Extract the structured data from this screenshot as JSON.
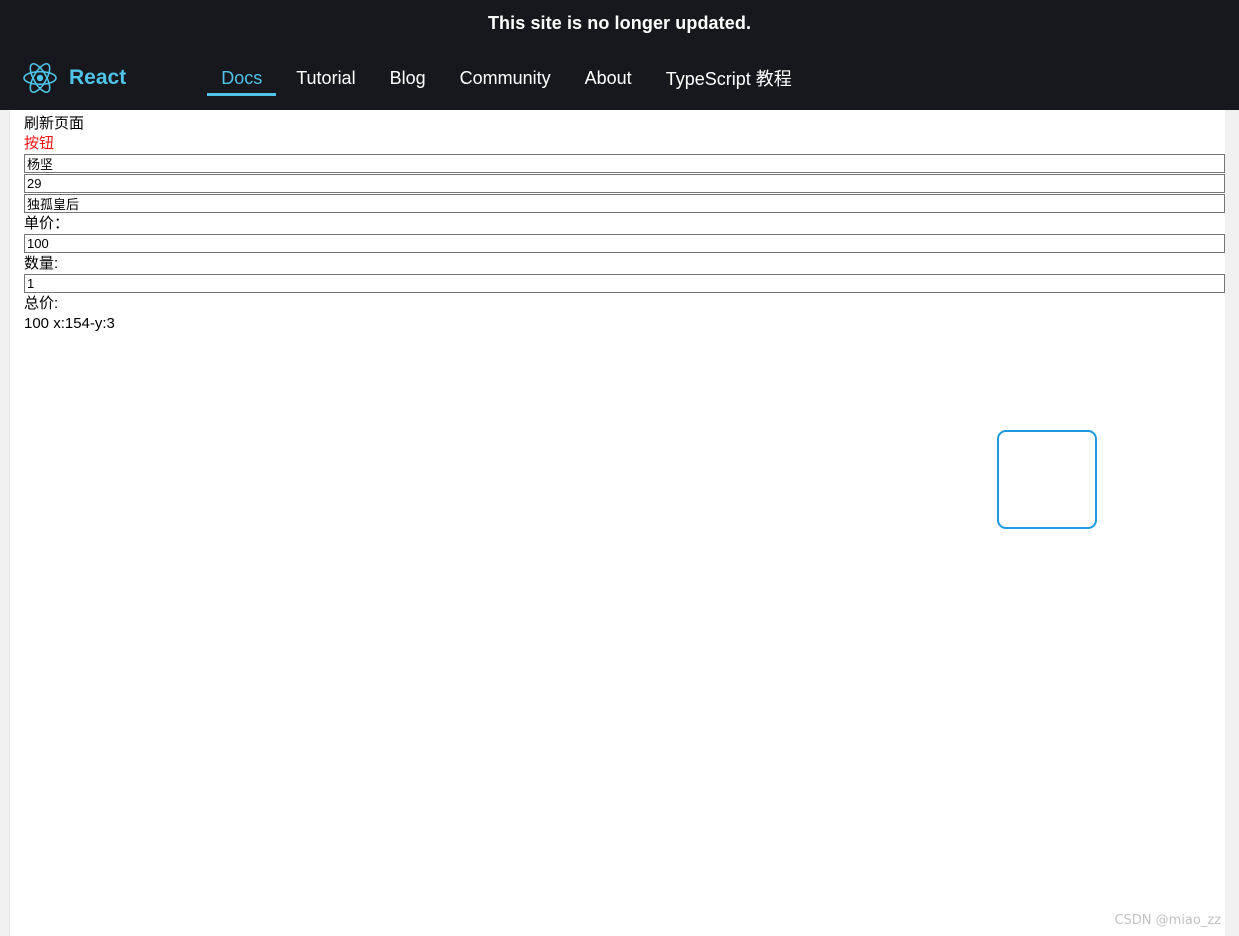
{
  "banner": {
    "text": "This site is no longer updated."
  },
  "navbar": {
    "brand": {
      "logo_icon": "react-atom-logo-icon",
      "name": "React",
      "color": "#4fc3e8"
    },
    "links": [
      {
        "label": "Docs",
        "active": true
      },
      {
        "label": "Tutorial",
        "active": false
      },
      {
        "label": "Blog",
        "active": false
      },
      {
        "label": "Community",
        "active": false
      },
      {
        "label": "About",
        "active": false
      },
      {
        "label": "TypeScript 教程",
        "active": false
      }
    ],
    "background": "#16181d",
    "active_color": "#4fc3e8"
  },
  "content": {
    "refresh_link": "刷新页面",
    "button_link": "按钮",
    "button_color": "#f21414",
    "inputs": {
      "name_value": "杨坚",
      "age_value": "29",
      "spouse_value": "独孤皇后",
      "unit_price_value": "100",
      "quantity_value": "1"
    },
    "labels": {
      "unit_price": "单价：",
      "quantity": "数量:",
      "total": "总价:"
    },
    "total_line": "100 x:154-y:3"
  },
  "blue_box": {
    "border_color": "#1e9ae0",
    "label": ""
  },
  "watermark": {
    "text": "CSDN @miao_zz"
  }
}
